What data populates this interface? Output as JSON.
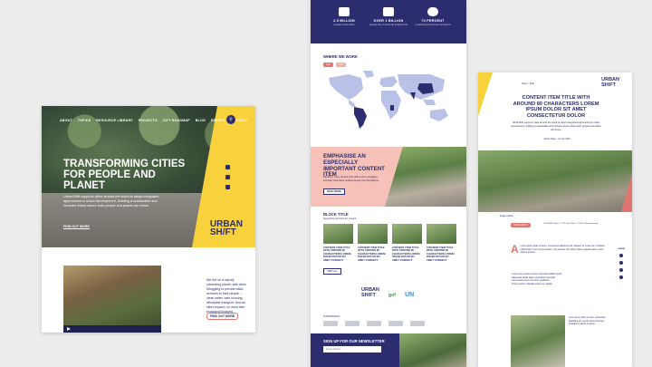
{
  "left": {
    "nav": [
      "ABOUT",
      "TOPICS",
      "RESOURCE LIBRARY",
      "PROJECTS",
      "CITY ROADMAP",
      "BLOG",
      "EVENTS",
      "CONTACT"
    ],
    "hero_title": "TRANSFORMING CITIES FOR PEOPLE AND PLANET",
    "hero_desc": "UrbanShift supports cities around the world to adopt integrated approaches to urban development, building a sustainable and inclusive future where both people and planet can thrive.",
    "hero_cta": "FIND OUT MORE",
    "logo_line1": "URBAN",
    "logo_line2": "SH/FT",
    "body_text": "We live on a rapidly urbanizing planet, with cities struggling to provide basic services to their people – clean water, safe housing, affordable transport. And as cities expand, so does their ecological footprint.",
    "body_cta": "FIND OUT MORE"
  },
  "mid": {
    "stats": [
      {
        "value": "2.9 BILLION",
        "label": "people in the cities"
      },
      {
        "value": "OVER 1 BILLION",
        "label": "people live in informal settlements"
      },
      {
        "value": "70 PERCENT",
        "label": "of global greenhouse emissions"
      }
    ],
    "where_title": "WHERE WE WORK",
    "tags": [
      "TAG",
      "TAG"
    ],
    "feature_title": "EMPHASISE AN ESPECIALLY IMPORTANT CONTENT ITEM",
    "feature_text": "Reinforce a key content point with a short, engaging summary that draws readers deeper into the platform.",
    "feature_btn": "READ MORE",
    "block_title": "BLOCK TITLE",
    "block_sub": "Supporting text here for content",
    "cards": [
      "CONTENT ITEM TITLE WITH AROUND 80 CHARACTERS LOREM IPSUM DOLOR SIT AMET CONSECT",
      "CONTENT ITEM TITLE WITH AROUND 80 CHARACTERS LOREM IPSUM DOLOR SIT AMET CONSECT",
      "CONTENT ITEM TITLE WITH AROUND 80 CHARACTERS LOREM IPSUM DOLOR SIT AMET CONSECT",
      "CONTENT ITEM TITLE WITH AROUND 80 CHARACTERS LOREM IPSUM DOLOR SIT AMET CONSECT"
    ],
    "more_btn": "VIEW ALL",
    "logo_urban": "URBAN",
    "logo_shift": "SH/FT",
    "logo_gef": "gef",
    "logo_un": "UN",
    "partners_label": "SUPPORTED BY",
    "newsletter_title": "SIGN UP FOR OUR NEWSLETTER",
    "newsletter_placeholder": "Email address"
  },
  "right": {
    "logo_line1": "URBAN",
    "logo_line2": "SH/FT",
    "crumb": "Home > Blog",
    "title": "CONTENT ITEM TITLE WITH AROUND 80 CHARACTERS LOREM IPSUM DOLOR SIT AMET CONSECTETUR DOLOR",
    "intro": "UrbanShift supports cities around the world to adopt integrated approaches to urban development, building a sustainable and inclusive future where both people and planet can thrive.",
    "meta": "Author Name  ·  01 Jan 2022",
    "caption": "Image caption",
    "tag": "PUBLICATION",
    "info": "COUNTRY: Brazil  ·  CITY: Sao Paulo  ·  TOPIC: Urban planning",
    "article": "Lorem ipsum dolor sit amet, consectetur adipiscing elit. Aliquam ac ornare dui. Curabitur ullamcorper mi et orci fermentum, non posuere nisl rutrum. Etiam egestas ipsum a felis ultrices pretium.",
    "dropcap": "A",
    "share_label": "SHARE",
    "bullets": [
      "Lorem ipsum dolor sit amet consectetur adipiscing elit",
      "Maecenas lacinia sapien at tincidunt commodo",
      "Sed molestie lacus nec tortor vestibulum",
      "Donec pretium vulputate sapien nec sagittis"
    ],
    "side_text": "Lorem ipsum dolor sit amet, consectetur adipiscing elit, sed do eiusmod tempor incididunt ut labore et dolore."
  }
}
